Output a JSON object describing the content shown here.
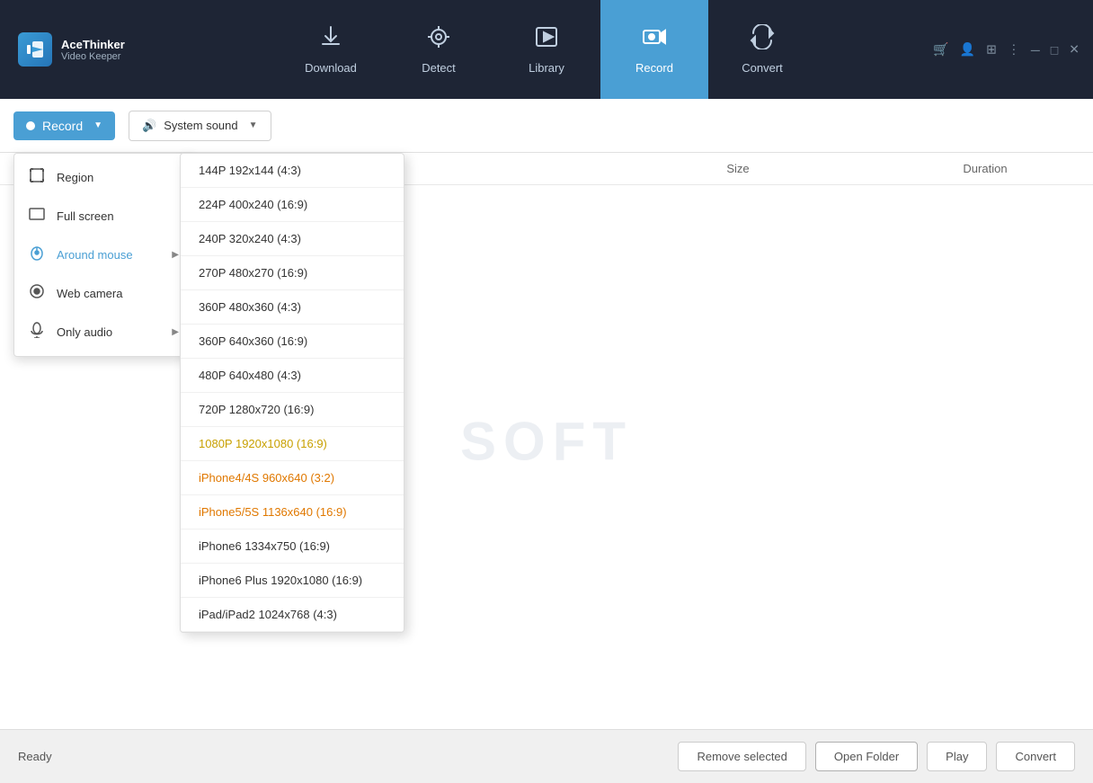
{
  "app": {
    "name_line1": "AceThinker",
    "name_line2": "Video Keeper"
  },
  "nav": {
    "tabs": [
      {
        "id": "download",
        "label": "Download",
        "icon": "⬇"
      },
      {
        "id": "detect",
        "label": "Detect",
        "icon": "◎"
      },
      {
        "id": "library",
        "label": "Library",
        "icon": "▶"
      },
      {
        "id": "record",
        "label": "Record",
        "icon": "🎥",
        "active": true
      },
      {
        "id": "convert",
        "label": "Convert",
        "icon": "↻"
      }
    ]
  },
  "toolbar": {
    "record_label": "Record",
    "sound_label": "System sound"
  },
  "table": {
    "headers": {
      "name": "",
      "size": "Size",
      "duration": "Duration"
    },
    "watermark": "SOFT"
  },
  "record_menu": {
    "items": [
      {
        "id": "region",
        "label": "Region",
        "icon": "region"
      },
      {
        "id": "full-screen",
        "label": "Full screen",
        "icon": "fullscreen"
      },
      {
        "id": "around-mouse",
        "label": "Around mouse",
        "icon": "mouse",
        "highlighted": true,
        "has_arrow": true
      },
      {
        "id": "web-camera",
        "label": "Web camera",
        "icon": "camera"
      },
      {
        "id": "only-audio",
        "label": "Only audio",
        "icon": "audio",
        "has_arrow": true
      }
    ]
  },
  "resolution_menu": {
    "items": [
      {
        "id": "144p-43",
        "label": "144P 192x144 (4:3)",
        "color": "normal"
      },
      {
        "id": "224p-169",
        "label": "224P 400x240 (16:9)",
        "color": "normal"
      },
      {
        "id": "240p-43",
        "label": "240P 320x240 (4:3)",
        "color": "normal"
      },
      {
        "id": "270p-169",
        "label": "270P 480x270 (16:9)",
        "color": "normal"
      },
      {
        "id": "360p-43",
        "label": "360P 480x360 (4:3)",
        "color": "normal"
      },
      {
        "id": "360p-169",
        "label": "360P 640x360 (16:9)",
        "color": "normal"
      },
      {
        "id": "480p-43",
        "label": "480P 640x480 (4:3)",
        "color": "normal"
      },
      {
        "id": "720p-169",
        "label": "720P 1280x720 (16:9)",
        "color": "normal"
      },
      {
        "id": "1080p-169",
        "label": "1080P 1920x1080 (16:9)",
        "color": "highlighted"
      },
      {
        "id": "iphone4",
        "label": "iPhone4/4S 960x640 (3:2)",
        "color": "orange"
      },
      {
        "id": "iphone5",
        "label": "iPhone5/5S 1136x640 (16:9)",
        "color": "orange"
      },
      {
        "id": "iphone6",
        "label": "iPhone6 1334x750 (16:9)",
        "color": "normal"
      },
      {
        "id": "iphone6plus",
        "label": "iPhone6 Plus 1920x1080 (16:9)",
        "color": "normal"
      },
      {
        "id": "ipad",
        "label": "iPad/iPad2 1024x768 (4:3)",
        "color": "normal"
      }
    ]
  },
  "bottom": {
    "status": "Ready",
    "buttons": {
      "remove": "Remove selected",
      "open_folder": "Open Folder",
      "play": "Play",
      "convert": "Convert"
    }
  }
}
